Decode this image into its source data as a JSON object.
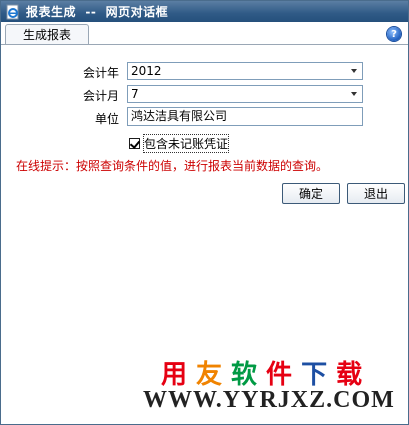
{
  "window": {
    "title": "报表生成  --  网页对话框",
    "accent_color": "#2f5a86"
  },
  "tabs": [
    {
      "label": "生成报表",
      "active": true
    }
  ],
  "help": {
    "icon": "help-icon",
    "glyph": "?"
  },
  "form": {
    "year": {
      "label": "会计年",
      "value": "2012"
    },
    "month": {
      "label": "会计月",
      "value": "7"
    },
    "unit": {
      "label": "单位",
      "value": "鸿达洁具有限公司"
    },
    "include_unposted": {
      "label": "包含未记账凭证",
      "checked": true
    }
  },
  "hint": "在线提示：按照查询条件的值，进行报表当前数据的查询。",
  "hint_color": "#cc0000",
  "buttons": {
    "ok": "确定",
    "exit": "退出"
  },
  "watermark": {
    "chars": [
      {
        "text": "用",
        "color": "#e60012"
      },
      {
        "text": "友",
        "color": "#f08300"
      },
      {
        "text": "软",
        "color": "#009a44"
      },
      {
        "text": "件",
        "color": "#e60012"
      },
      {
        "text": "下",
        "color": "#1d4fa3"
      },
      {
        "text": "载",
        "color": "#e60012"
      }
    ],
    "url": "WWW.YYRJXZ.COM"
  }
}
